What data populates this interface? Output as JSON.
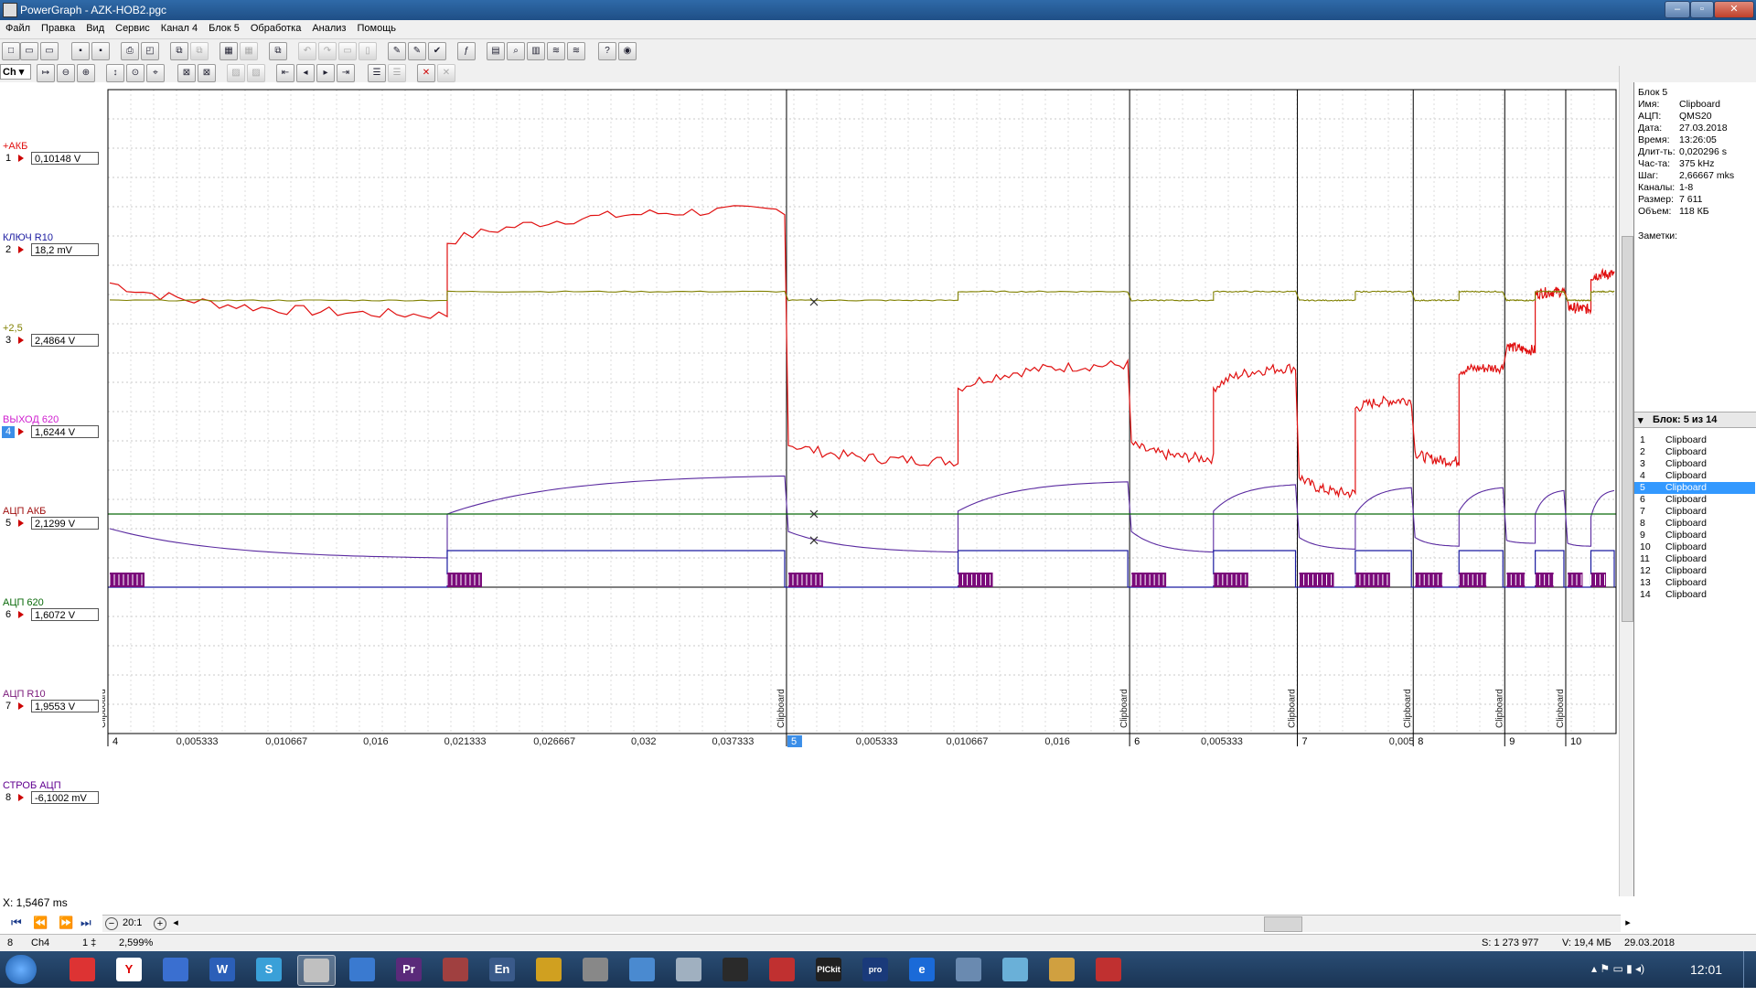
{
  "window": {
    "title": "PowerGraph - AZK-HOB2.pgc",
    "controls": [
      "–",
      "▫",
      "✕"
    ]
  },
  "menu": [
    "Файл",
    "Правка",
    "Вид",
    "Сервис",
    "Канал 4",
    "Блок 5",
    "Обработка",
    "Анализ",
    "Помощь"
  ],
  "toolbar2": {
    "channel_select": "Ch"
  },
  "channels": [
    {
      "num": "1",
      "name": "+АКБ",
      "value": "0,10148 V",
      "color": "#e01010"
    },
    {
      "num": "2",
      "name": "КЛЮЧ R10",
      "value": "18,2 mV",
      "color": "#1a1aa0"
    },
    {
      "num": "3",
      "name": "+2,5",
      "value": "2,4864 V",
      "color": "#808000"
    },
    {
      "num": "4",
      "name": "ВЫХОД 620",
      "value": "1,6244 V",
      "color": "#d020d0"
    },
    {
      "num": "5",
      "name": "АЦП АКБ",
      "value": "2,1299 V",
      "color": "#a01010"
    },
    {
      "num": "6",
      "name": "АЦП 620",
      "value": "1,6072 V",
      "color": "#0a6a0a"
    },
    {
      "num": "7",
      "name": "АЦП R10",
      "value": "1,9553 V",
      "color": "#7a1a7a"
    },
    {
      "num": "8",
      "name": "СТРОБ АЦП",
      "value": "-6,1002 mV",
      "color": "#600090"
    }
  ],
  "x_readout": "X: 1,5467 ms",
  "info": {
    "block": "Блок 5",
    "rows": [
      {
        "k": "Имя:",
        "v": "Clipboard"
      },
      {
        "k": "АЦП:",
        "v": "QMS20"
      },
      {
        "k": "Дата:",
        "v": "27.03.2018"
      },
      {
        "k": "Время:",
        "v": "13:26:05"
      },
      {
        "k": "Длит-ть:",
        "v": "0,020296 s"
      },
      {
        "k": "Час-та:",
        "v": "375 kHz"
      },
      {
        "k": "Шаг:",
        "v": "2,66667 mks"
      },
      {
        "k": "Каналы:",
        "v": "1-8"
      },
      {
        "k": "Размер:",
        "v": "7 611"
      },
      {
        "k": "Объем:",
        "v": "118 КБ"
      }
    ],
    "notes_label": "Заметки:"
  },
  "blocks": {
    "header": "Блок: 5 из 14",
    "selected": 5,
    "items": [
      {
        "n": "1",
        "label": "Clipboard"
      },
      {
        "n": "2",
        "label": "Clipboard"
      },
      {
        "n": "3",
        "label": "Clipboard"
      },
      {
        "n": "4",
        "label": "Clipboard"
      },
      {
        "n": "5",
        "label": "Clipboard"
      },
      {
        "n": "6",
        "label": "Clipboard"
      },
      {
        "n": "7",
        "label": "Clipboard"
      },
      {
        "n": "8",
        "label": "Clipboard"
      },
      {
        "n": "9",
        "label": "Clipboard"
      },
      {
        "n": "10",
        "label": "Clipboard"
      },
      {
        "n": "11",
        "label": "Clipboard"
      },
      {
        "n": "12",
        "label": "Clipboard"
      },
      {
        "n": "13",
        "label": "Clipboard"
      },
      {
        "n": "14",
        "label": "Clipboard"
      }
    ]
  },
  "chart_data": {
    "type": "line",
    "y_ticks": [
      "17",
      "16",
      "15",
      "14",
      "13",
      "12",
      "11",
      "10",
      "9",
      "8",
      "7",
      "6",
      "5",
      "4",
      "3",
      "2",
      "1",
      "0",
      "-1",
      "-2",
      "-3",
      "-4",
      "-5"
    ],
    "ylim": [
      -5,
      17
    ],
    "segment_boundaries": [
      {
        "label": "Clipboard",
        "block": "4"
      },
      {
        "label": "Clipboard",
        "block": "5"
      },
      {
        "label": "Clipboard",
        "block": "6"
      },
      {
        "label": "Clipboard",
        "block": "7"
      },
      {
        "label": "Clipboard",
        "block": "8"
      },
      {
        "label": "Clipboard",
        "block": "9"
      },
      {
        "label": "Clipboard",
        "block": "10"
      }
    ],
    "x_tick_labels": [
      "0,005333",
      "0,010667",
      "0,016",
      "0,021333",
      "0,026667",
      "0,032",
      "0,037333",
      "0,005333",
      "0,010667",
      "0,016",
      "0,005333",
      "0,005"
    ],
    "segment_fractions": [
      0.445,
      0.225,
      0.11,
      0.076,
      0.06,
      0.04,
      0.033
    ],
    "series": [
      {
        "channel": "1",
        "color": "#e01010",
        "segments": [
          [
            10.4,
            9.3,
            11.8,
            12.9
          ],
          [
            4.9,
            4.3,
            6.8,
            7.6
          ],
          [
            4.9,
            4.4,
            6.8,
            7.5
          ],
          [
            3.8,
            3.2,
            6.1,
            6.4
          ],
          [
            4.6,
            4.3,
            7.4,
            7.5
          ],
          [
            8.3,
            8.1,
            10.0,
            10.1
          ],
          [
            9.6,
            9.5,
            10.6,
            10.7
          ]
        ]
      },
      {
        "channel": "3",
        "color": "#808000",
        "segments": [
          [
            9.8,
            9.8,
            10.1,
            10.1
          ],
          [
            9.8,
            9.8,
            10.1,
            10.1
          ],
          [
            9.8,
            9.8,
            10.1,
            10.1
          ],
          [
            9.8,
            9.8,
            10.1,
            10.1
          ],
          [
            9.8,
            9.8,
            10.1,
            10.1
          ],
          [
            9.8,
            9.8,
            10.1,
            10.1
          ],
          [
            9.8,
            9.8,
            10.1,
            10.1
          ]
        ]
      },
      {
        "channel": "7",
        "color": "#5a2aa0",
        "segments": [
          [
            2.0,
            1.0,
            2.5,
            3.8
          ],
          [
            1.9,
            1.2,
            2.6,
            3.6
          ],
          [
            1.9,
            1.2,
            2.6,
            3.5
          ],
          [
            1.7,
            1.3,
            2.5,
            3.4
          ],
          [
            1.7,
            1.4,
            2.6,
            3.4
          ],
          [
            1.6,
            1.5,
            2.5,
            3.3
          ],
          [
            1.5,
            1.4,
            2.4,
            3.3
          ]
        ]
      }
    ],
    "steady_levels": [
      {
        "channel": "6",
        "color": "#0a6a0a",
        "value": 2.5
      }
    ],
    "pulse_level": {
      "channel": "2",
      "color": "#1a1aa0",
      "low": 0.0,
      "high": 1.25
    },
    "strobe": {
      "channel": "8",
      "color": "#7a0a7a",
      "low": 0.0,
      "high": 0.5
    }
  },
  "hscroll": {
    "zoom": "20:1"
  },
  "status": {
    "num": "8",
    "channel": "Ch4",
    "ratio": "1 ‡",
    "percent": "2,599%",
    "samples": "S: 1 273 977",
    "volume": "V: 19,4 МБ",
    "date": "29.03.2018"
  },
  "taskbar": {
    "clock": "12:01",
    "apps": [
      "",
      "Y",
      "",
      "W",
      "S",
      "",
      "",
      "Pr",
      "",
      "En",
      "",
      "",
      "",
      "",
      "",
      "",
      "PICkit 2",
      "pro AIS",
      "e",
      "",
      "",
      "",
      ""
    ]
  }
}
